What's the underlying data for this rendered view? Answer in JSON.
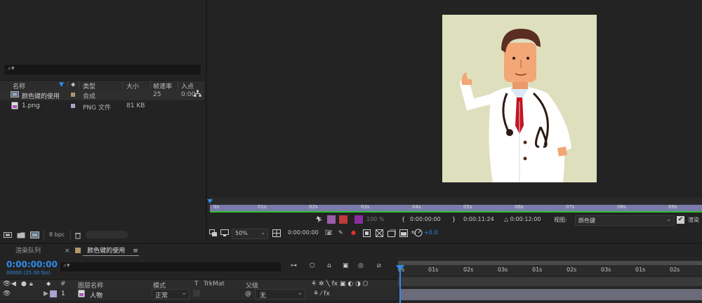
{
  "project": {
    "search_icon": "⌕▾",
    "columns": [
      "名称",
      "类型",
      "大小",
      "帧速率",
      "入点"
    ],
    "items": [
      {
        "name": "颜色键的使用",
        "type": "合成",
        "size": "",
        "fps": "25",
        "in": "0:00",
        "label_color": "#b5946c",
        "icon": "composition-icon"
      },
      {
        "name": "1.png",
        "type": "PNG 文件",
        "size": "81 KB",
        "fps": "",
        "in": "",
        "label_color": "#a7a2cf",
        "icon": "png-file-icon"
      }
    ],
    "bpc": "8 bpc"
  },
  "viewer": {
    "mini_ticks": [
      "0s",
      "01s",
      "02s",
      "03s",
      "04s",
      "05s",
      "06s",
      "07s",
      "08s",
      "09s"
    ],
    "bar1": {
      "opacity": "100 %",
      "start": "0:00:00:00",
      "end": "0:00:11:24",
      "duration": "△ 0:00:12:00",
      "view_label": "视图:",
      "view_value": "颜色键",
      "render_label": "渲染"
    },
    "bar2": {
      "zoom": "50%",
      "time": "0:00:00:00",
      "exposure": "+0.0"
    }
  },
  "timeline": {
    "tab_render": "渲染队列",
    "tab_comp_close": "×",
    "tab_comp": "颜色键的使用",
    "tab_menu": "≡",
    "timecode": "0:00:00:00",
    "frameinfo": "00000 (25.00 fps)",
    "search_icon": "⌕▾",
    "columns": {
      "num": "#",
      "name": "图层名称",
      "mode": "模式",
      "t": "T",
      "trkmat": "TrkMat",
      "parent": "父级"
    },
    "layer": {
      "num": "1",
      "name": "人物",
      "mode": "正常",
      "parent": "无"
    },
    "ruler_ticks": [
      "0s",
      "01s",
      "02s",
      "03s",
      "01s",
      "02s",
      "03s",
      "01s",
      "02s"
    ]
  },
  "colors": {
    "accent": "#2d8ceb",
    "timeline_green": "#2fbf2f",
    "comp_bg": "#dedfbd"
  }
}
